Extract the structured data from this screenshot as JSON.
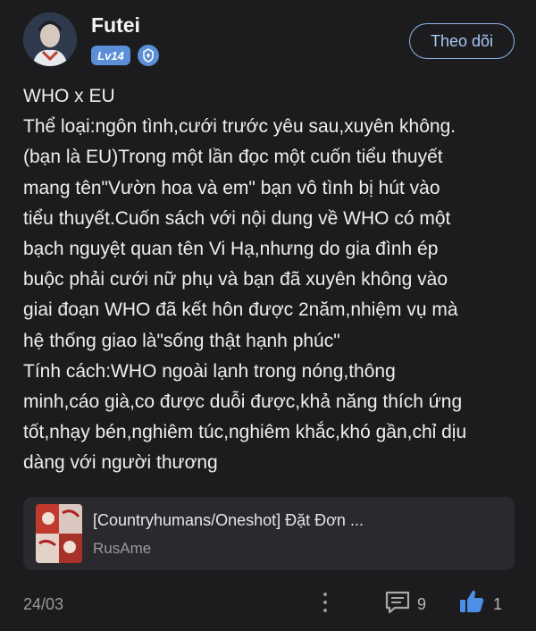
{
  "author": {
    "name": "Futei",
    "level": "Lv14",
    "avatar_icon": "avatar",
    "verified_icon": "shield-icon"
  },
  "follow_button": {
    "label": "Theo dõi"
  },
  "post": {
    "lines": [
      "WHO x EU",
      "Thể loại:ngôn tình,cưới trước yêu sau,xuyên không.",
      "(bạn là EU)Trong một lần đọc một cuốn tiểu thuyết",
      "mang tên\"Vườn hoa và em\" bạn vô tình bị hút vào",
      "tiểu thuyết.Cuốn sách với nội dung về WHO có một",
      "bạch nguyệt quan tên Vi Hạ,nhưng do gia đình ép",
      "buộc phải cưới nữ phụ và bạn đã xuyên không vào",
      "giai đoạn WHO đã kết hôn được 2năm,nhiệm vụ mà",
      "hệ thống giao là\"sống thật hạnh phúc\"",
      "Tính cách:WHO ngoài lạnh trong nóng,thông",
      "minh,cáo già,co được duỗi được,khả năng thích ứng",
      "tốt,nhạy bén,nghiêm túc,nghiêm khắc,khó gần,chỉ dịu",
      "dàng với người thương"
    ]
  },
  "linked_story": {
    "title": "[Countryhumans/Oneshot] Đặt Đơn ...",
    "author": "RusAme"
  },
  "footer": {
    "date": "24/03",
    "comment_count": "9",
    "like_count": "1"
  },
  "colors": {
    "background": "#1c1c1e",
    "accent": "#5b8fd8",
    "follow_border": "#8fb6ee",
    "card_background": "#2a2a2e",
    "muted_text": "#9a9a9a"
  }
}
